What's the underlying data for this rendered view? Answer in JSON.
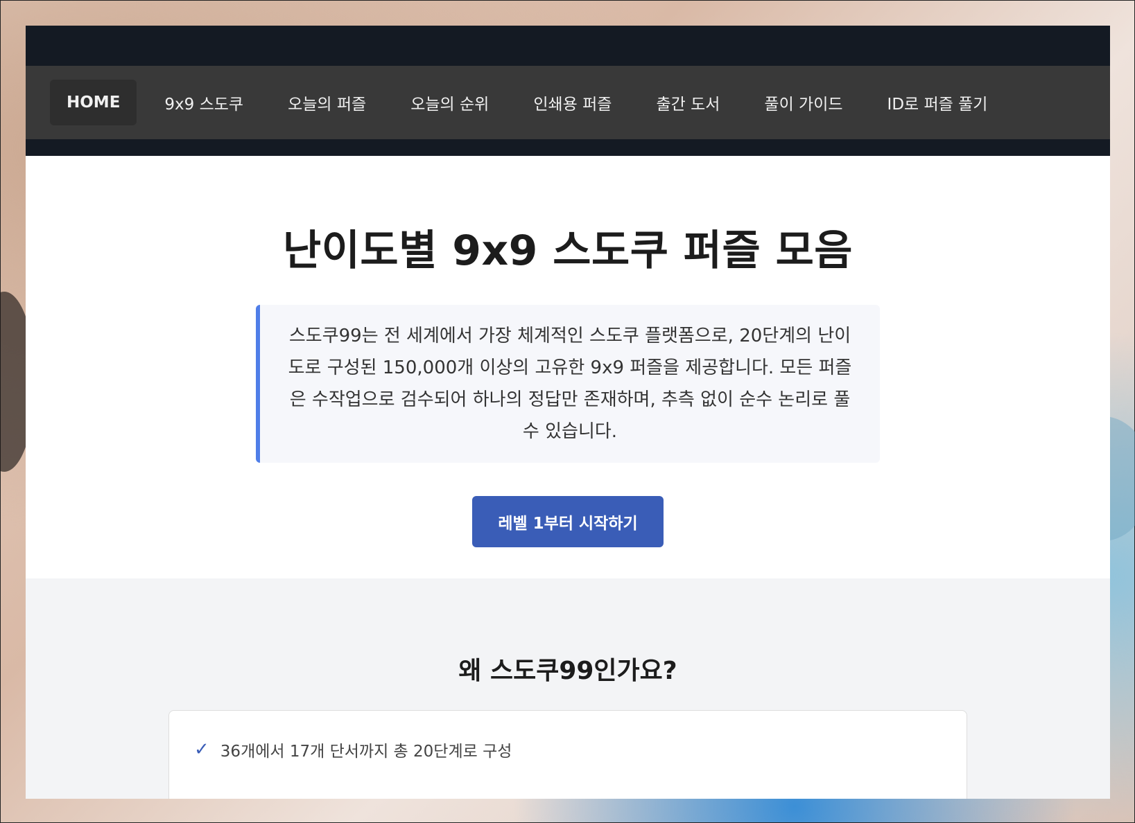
{
  "nav": {
    "items": [
      {
        "label": "HOME",
        "active": true
      },
      {
        "label": "9x9 스도쿠"
      },
      {
        "label": "오늘의 퍼즐"
      },
      {
        "label": "오늘의 순위"
      },
      {
        "label": "인쇄용 퍼즐"
      },
      {
        "label": "출간 도서"
      },
      {
        "label": "풀이 가이드"
      },
      {
        "label": "ID로 퍼즐 풀기"
      }
    ]
  },
  "hero": {
    "title": "난이도별 9x9 스도쿠 퍼즐 모음",
    "intro": "스도쿠99는 전 세계에서 가장 체계적인 스도쿠 플랫폼으로, 20단계의 난이도로 구성된 150,000개 이상의 고유한 9x9 퍼즐을 제공합니다. 모든 퍼즐은 수작업으로 검수되어 하나의 정답만 존재하며, 추측 없이 순수 논리로 풀 수 있습니다.",
    "cta_label": "레벨 1부터 시작하기"
  },
  "why": {
    "title": "왜 스도쿠99인가요?",
    "features": [
      {
        "check": "✓",
        "text": "36개에서 17개 단서까지 총 20단계로 구성"
      }
    ]
  },
  "colors": {
    "accent": "#3a5db7",
    "intro_border": "#4f7ee8",
    "nav_bg": "#393939",
    "topbar_bg": "#141a23"
  }
}
